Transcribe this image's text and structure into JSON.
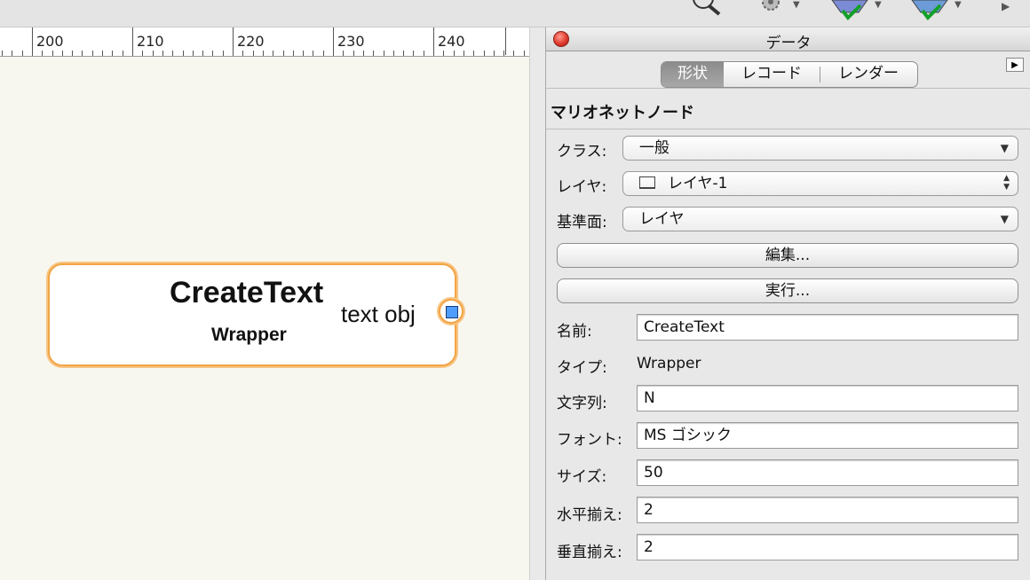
{
  "toolbar": {
    "icons": [
      "zoom-icon",
      "gear-icon",
      "globe-check-icon",
      "globe-check-icon-2"
    ]
  },
  "ruler": {
    "labels": [
      "200",
      "210",
      "220",
      "230",
      "240"
    ]
  },
  "node": {
    "title": "CreateText",
    "subtitle": "Wrapper",
    "port_label": "text obj"
  },
  "palette": {
    "title": "データ",
    "tabs": [
      {
        "label": "形状",
        "active": true
      },
      {
        "label": "レコード",
        "active": false
      },
      {
        "label": "レンダー",
        "active": false
      }
    ],
    "section_title": "マリオネットノード",
    "class": {
      "label": "クラス:",
      "value": "一般"
    },
    "layer": {
      "label": "レイヤ:",
      "value": "レイヤ-1"
    },
    "plane": {
      "label": "基準面:",
      "value": "レイヤ"
    },
    "edit_button": "編集...",
    "run_button": "実行...",
    "name": {
      "label": "名前:",
      "value": "CreateText"
    },
    "type": {
      "label": "タイプ:",
      "value": "Wrapper"
    },
    "string": {
      "label": "文字列:",
      "value": "N"
    },
    "font": {
      "label": "フォント:",
      "value": "MS ゴシック"
    },
    "size": {
      "label": "サイズ:",
      "value": "50"
    },
    "halign": {
      "label": "水平揃え:",
      "value": "2"
    },
    "valign": {
      "label": "垂直揃え:",
      "value": "2"
    }
  },
  "colors": {
    "node_border": "#f2a446",
    "port_fill": "#4f9dff",
    "canvas_bg": "#f8f7ef"
  }
}
